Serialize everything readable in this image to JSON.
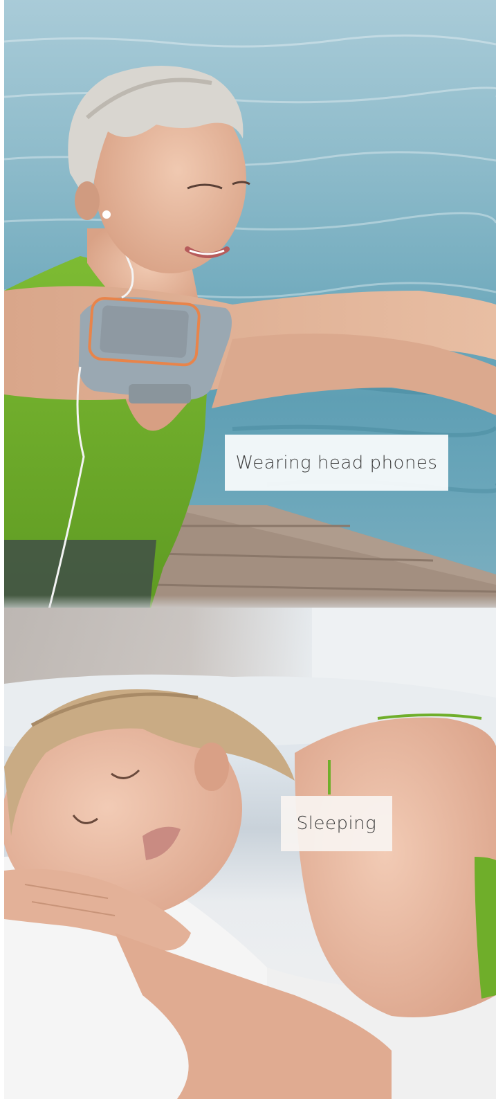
{
  "captions": {
    "activity_1": "Wearing head phones",
    "activity_2": "Sleeping"
  },
  "colors": {
    "water": "#6aa6ba",
    "tank_top": "#6fae2a",
    "armband": "#9aa8b2",
    "armband_trim": "#e8844a",
    "dock_wood": "#a08e80",
    "caption_bg": "#ffffff",
    "caption_text": "#3c3c3c"
  }
}
